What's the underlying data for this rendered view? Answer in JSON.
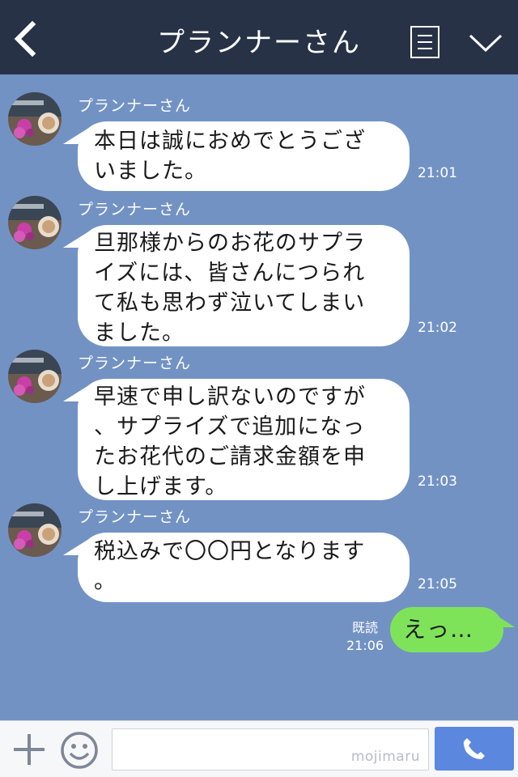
{
  "header": {
    "title": "プランナーさん",
    "back_icon": "chevron-left-icon",
    "menu_icon": "list-menu-icon",
    "collapse_icon": "chevron-down-icon"
  },
  "messages": [
    {
      "sender": "プランナーさん",
      "lines": [
        "本日は誠におめでとうござ",
        "いました。"
      ],
      "time": "21:01"
    },
    {
      "sender": "プランナーさん",
      "lines": [
        "旦那様からのお花のサプラ",
        "イズには、皆さんにつられ",
        "て私も思わず泣いてしまい",
        "ました。"
      ],
      "time": "21:02"
    },
    {
      "sender": "プランナーさん",
      "lines": [
        "早速で申し訳ないのですが",
        "、サプライズで追加になっ",
        "たお花代のご請求金額を申",
        "し上げます。"
      ],
      "time": "21:03"
    },
    {
      "sender": "プランナーさん",
      "lines": [
        "税込みで〇〇円となります",
        "。"
      ],
      "time": "21:05"
    }
  ],
  "my_message": {
    "text": "えっ…",
    "read_label": "既読",
    "time": "21:06"
  },
  "footer": {
    "input_value": "",
    "watermark": "mojimaru",
    "plus_icon": "plus-icon",
    "emoji_icon": "smiley-icon",
    "call_icon": "phone-icon"
  },
  "colors": {
    "header_bg": "#273247",
    "chat_bg": "#7292c4",
    "my_bubble": "#7fe35a",
    "call_button": "#5b87df"
  }
}
